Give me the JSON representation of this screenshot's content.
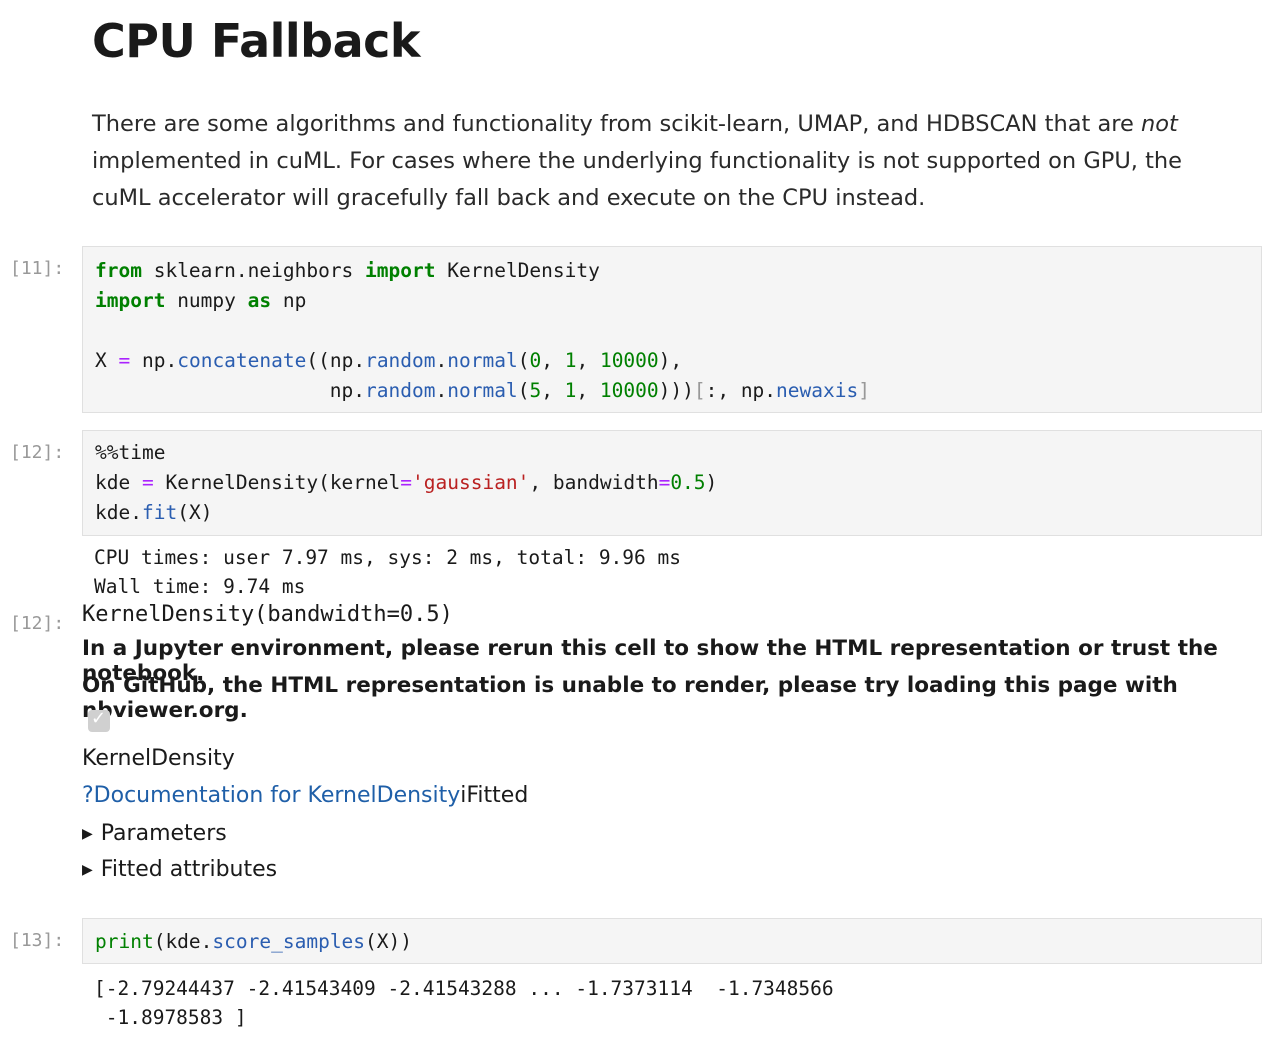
{
  "heading": "CPU Fallback",
  "intro": {
    "before": "There are some algorithms and functionality from scikit-learn, UMAP, and HDBSCAN that are ",
    "emphasis": "not",
    "after": " implemented in cuML. For cases where the underlying functionality is not supported on GPU, the cuML accelerator will gracefully fall back and execute on the CPU instead."
  },
  "cells": [
    {
      "prompt": "[11]:",
      "code_lines": [
        "from sklearn.neighbors import KernelDensity",
        "import numpy as np",
        "",
        "X = np.concatenate((np.random.normal(0, 1, 10000),",
        "                    np.random.normal(5, 1, 10000)))[:, np.newaxis]"
      ]
    },
    {
      "prompt": "[12]:",
      "code_lines": [
        "%%time",
        "kde = KernelDensity(kernel='gaussian', bandwidth=0.5)",
        "kde.fit(X)"
      ],
      "stream_output": [
        "CPU times: user 7.97 ms, sys: 2 ms, total: 9.96 ms",
        "Wall time: 9.74 ms"
      ],
      "result_prompt": "[12]:",
      "result_repr": "KernelDensity(bandwidth=0.5)",
      "warning_lines": [
        "In a Jupyter environment, please rerun this cell to show the HTML representation or trust the notebook.",
        "On GitHub, the HTML representation is unable to render, please try loading this page with nbviewer.org."
      ],
      "estimator_name": "KernelDensity",
      "doc_link": "?Documentation for KernelDensity",
      "fitted_label": "iFitted",
      "sections": [
        "Parameters",
        "Fitted attributes"
      ]
    },
    {
      "prompt": "[13]:",
      "code_lines": [
        "print(kde.score_samples(X))"
      ],
      "stream_output": [
        "[-2.79244437 -2.41543409 -2.41543288 ... -1.7373114  -1.7348566",
        " -1.8978583 ]"
      ]
    }
  ],
  "colors": {
    "keyword": "#008000",
    "function": "#2a5db0",
    "number": "#008000",
    "string": "#ba2121",
    "operator": "#aa22ff",
    "prompt": "#999999",
    "code_bg": "#f5f5f5",
    "link": "#1f5fa8"
  }
}
